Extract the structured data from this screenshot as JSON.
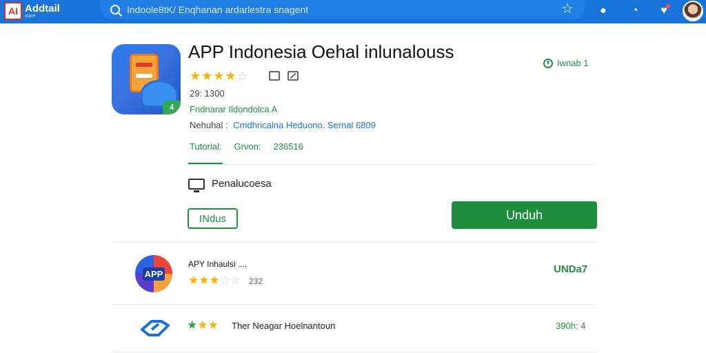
{
  "header": {
    "logo_mark": "AI",
    "logo_title": "Addtail",
    "logo_sub": "store",
    "search_placeholder": "Indoole8tK/ Enqhanan ardarlestra snagent"
  },
  "app": {
    "title": "APP Indonesia Oehal inlunalouss",
    "rating_stars": "★★★★",
    "rating_half": "☆",
    "reviews": "29: 1300",
    "developer": "Fndnarar Ildondolca A",
    "meta_label": "Nehuhal :",
    "meta_link": "Cmdhricalna Heduono. Sernal 6809",
    "tabs": [
      "Tutorial:",
      "Grvon:",
      "236516"
    ],
    "version": "Iwnab 1",
    "device_text": "Penalucoesa",
    "wishlist_label": "INdus",
    "install_label": "Unduh",
    "icon_badge": "4"
  },
  "related": [
    {
      "icon_text": "APP",
      "name": "APY Inhaulsi ....",
      "stars": "★★★",
      "stars_empty": "☆☆",
      "count": "232",
      "action": "UNDa7"
    },
    {
      "stars_green": "★",
      "stars_yellow": "★★",
      "name": "Ther Neagar Hoelnantoun",
      "action": "390h: 4"
    }
  ],
  "colors": {
    "brand": "#1a73d9",
    "accent": "#1e8e3e",
    "star": "#f4b400"
  }
}
